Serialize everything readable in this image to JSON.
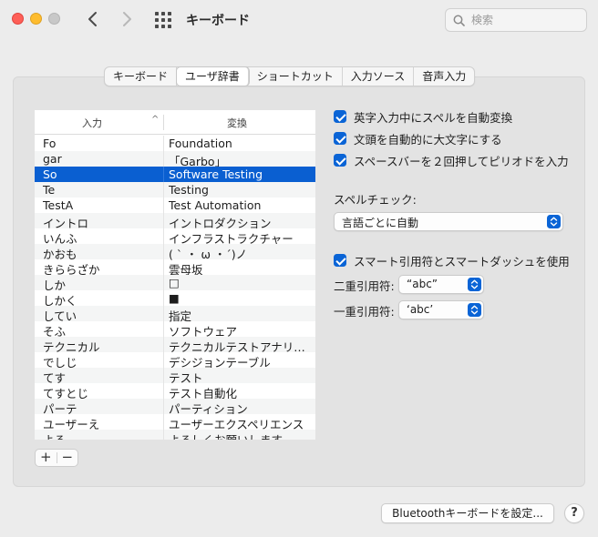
{
  "window": {
    "title": "キーボード",
    "search_placeholder": "検索"
  },
  "tabs": [
    {
      "label": "キーボード",
      "active": false
    },
    {
      "label": "ユーザ辞書",
      "active": true
    },
    {
      "label": "ショートカット",
      "active": false
    },
    {
      "label": "入力ソース",
      "active": false
    },
    {
      "label": "音声入力",
      "active": false
    }
  ],
  "dictionary": {
    "col_input": "入力",
    "col_convert": "変換",
    "sort_indicator": "^",
    "rows": [
      {
        "input": "Fo",
        "output": "Foundation"
      },
      {
        "input": "gar",
        "output": "「Garbo」"
      },
      {
        "input": "So",
        "output": "Software Testing",
        "selected": true
      },
      {
        "input": "Te",
        "output": "Testing"
      },
      {
        "input": "TestA",
        "output": "Test Automation"
      },
      {
        "input": "イントロ",
        "output": "イントロダクション"
      },
      {
        "input": "いんふ",
        "output": "インフラストラクチャー"
      },
      {
        "input": "かおも",
        "output": "( ` ・ ω ・´)ノ"
      },
      {
        "input": "きららざか",
        "output": "雲母坂"
      },
      {
        "input": "しか",
        "output": "□"
      },
      {
        "input": "しかく",
        "output": "■"
      },
      {
        "input": "してい",
        "output": "指定"
      },
      {
        "input": "そふ",
        "output": "ソフトウェア"
      },
      {
        "input": "テクニカル",
        "output": "テクニカルテストアナリ…"
      },
      {
        "input": "でしじ",
        "output": "デシジョンテーブル"
      },
      {
        "input": "てす",
        "output": "テスト"
      },
      {
        "input": "てすとじ",
        "output": "テスト自動化"
      },
      {
        "input": "パーテ",
        "output": "パーティション"
      },
      {
        "input": "ユーザーえ",
        "output": "ユーザーエクスペリエンス"
      },
      {
        "input": "よろ",
        "output": "よろしくお願いします"
      }
    ],
    "add_label": "+",
    "remove_label": "−"
  },
  "options": {
    "auto_correct": {
      "label": "英字入力中にスペルを自動変換",
      "checked": true
    },
    "auto_capitalize": {
      "label": "文頭を自動的に大文字にする",
      "checked": true
    },
    "double_space_period": {
      "label": "スペースバーを２回押してピリオドを入力",
      "checked": true
    },
    "spell_check_label": "スペルチェック:",
    "spell_check_value": "言語ごとに自動",
    "smart_quotes": {
      "label": "スマート引用符とスマートダッシュを使用",
      "checked": true
    },
    "double_quote_label": "二重引用符:",
    "double_quote_value": "“abc”",
    "single_quote_label": "一重引用符:",
    "single_quote_value": "‘abc’"
  },
  "footer": {
    "bluetooth_button": "Bluetoothキーボードを設定...",
    "help_label": "?"
  },
  "colors": {
    "accent": "#0a64d6",
    "selection": "#0a5fd1"
  }
}
